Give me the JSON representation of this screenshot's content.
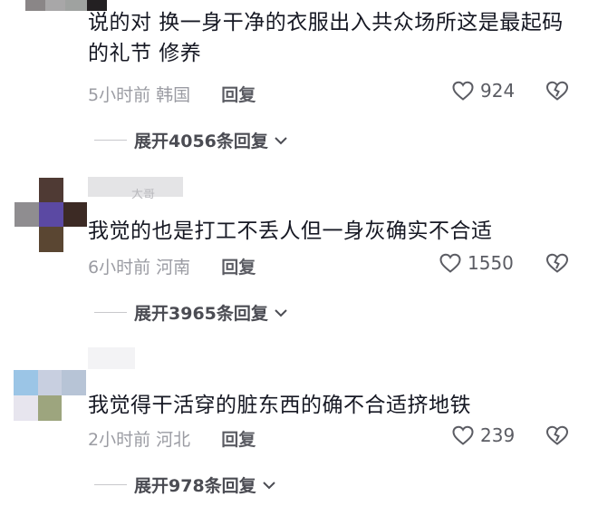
{
  "comments": [
    {
      "text": "说的对 换一身干净的衣服出入共众场所这是最起码的礼节 修养",
      "time": "5小时前",
      "location": "韩国",
      "reply_label": "回复",
      "likes": "924",
      "expand_label": "展开4056条回复"
    },
    {
      "username": "大哥",
      "text": "我觉的也是打工不丢人但一身灰确实不合适",
      "time": "6小时前",
      "location": "河南",
      "reply_label": "回复",
      "likes": "1550",
      "expand_label": "展开3965条回复"
    },
    {
      "text": "我觉得干活穿的脏东西的确不合适挤地铁",
      "time": "2小时前",
      "location": "河北",
      "reply_label": "回复",
      "likes": "239",
      "expand_label": "展开978条回复"
    }
  ],
  "icons": {
    "like": "heart-outline-icon",
    "dislike": "broken-heart-icon",
    "expand": "chevron-down-icon"
  },
  "colors": {
    "text": "#161823",
    "meta": "#9b9ca3",
    "reply": "#5b5c63"
  }
}
